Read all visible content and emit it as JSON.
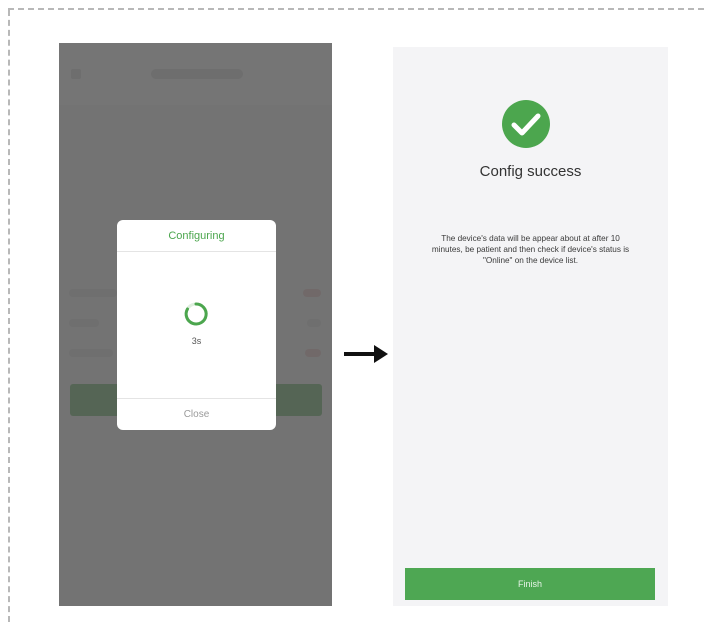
{
  "left_screen": {
    "dialog": {
      "title": "Configuring",
      "countdown": "3s",
      "close_label": "Close"
    }
  },
  "right_screen": {
    "title": "Config success",
    "message_line1": "The device's data will be appear about at after 10",
    "message_line2": "minutes,  be patient and then check if device's status is",
    "message_line3": "\"Online\" on the device list.",
    "finish_label": "Finish"
  },
  "icons": {
    "spinner": "loading-spinner-icon",
    "success": "check-circle-icon",
    "arrow": "arrow-right-icon"
  },
  "colors": {
    "accent_green": "#4ca64e",
    "overlay": "#585858",
    "dashed_border": "#b8b8b8"
  }
}
